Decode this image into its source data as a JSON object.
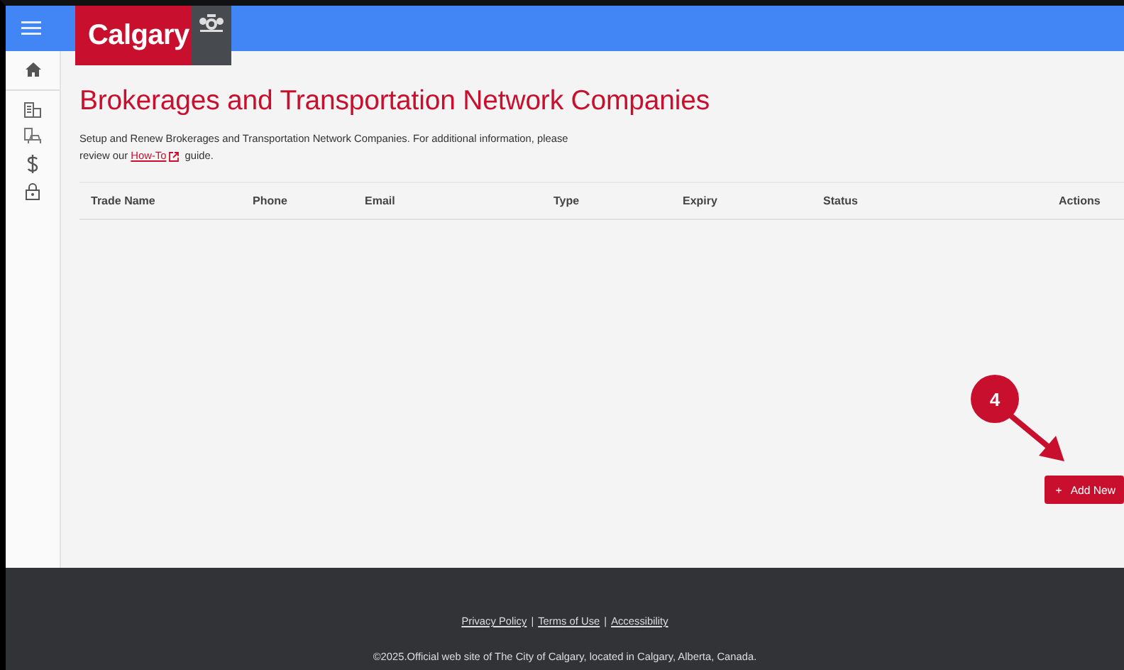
{
  "header": {
    "logo_text": "Calgary"
  },
  "page": {
    "title": "Brokerages and Transportation Network Companies",
    "description_before": "Setup and Renew Brokerages and Transportation Network Companies. For additional information, please review our ",
    "link": "How-To",
    "description_after": " guide."
  },
  "table": {
    "columns": [
      "Trade Name",
      "Phone",
      "Email",
      "Type",
      "Expiry",
      "Status",
      "Actions"
    ]
  },
  "callout": {
    "label": "4"
  },
  "add_button": {
    "icon": "+",
    "label": "Add New"
  },
  "footer": {
    "links": [
      "Privacy Policy",
      "Terms of Use",
      "Accessibility"
    ],
    "separator": "|",
    "copyright": "©2025.Official web site of The City of Calgary, located in Calgary, Alberta, Canada."
  }
}
